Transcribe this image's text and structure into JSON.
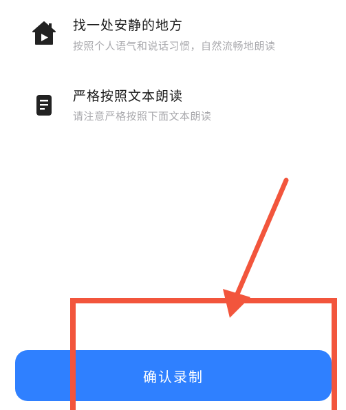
{
  "tips": [
    {
      "title": "找一处安静的地方",
      "subtitle": "按照个人语气和说话习惯，自然流畅地朗读",
      "icon": "home-play-icon"
    },
    {
      "title": "严格按照文本朗读",
      "subtitle": "请注意严格按照下面文本朗读",
      "icon": "document-icon"
    }
  ],
  "confirm_button": {
    "label": "确认录制"
  },
  "colors": {
    "accent": "#2f80ff",
    "annotation": "#f2553c",
    "title_text": "#1a1a1a",
    "subtitle_text": "#a9a9ad"
  }
}
